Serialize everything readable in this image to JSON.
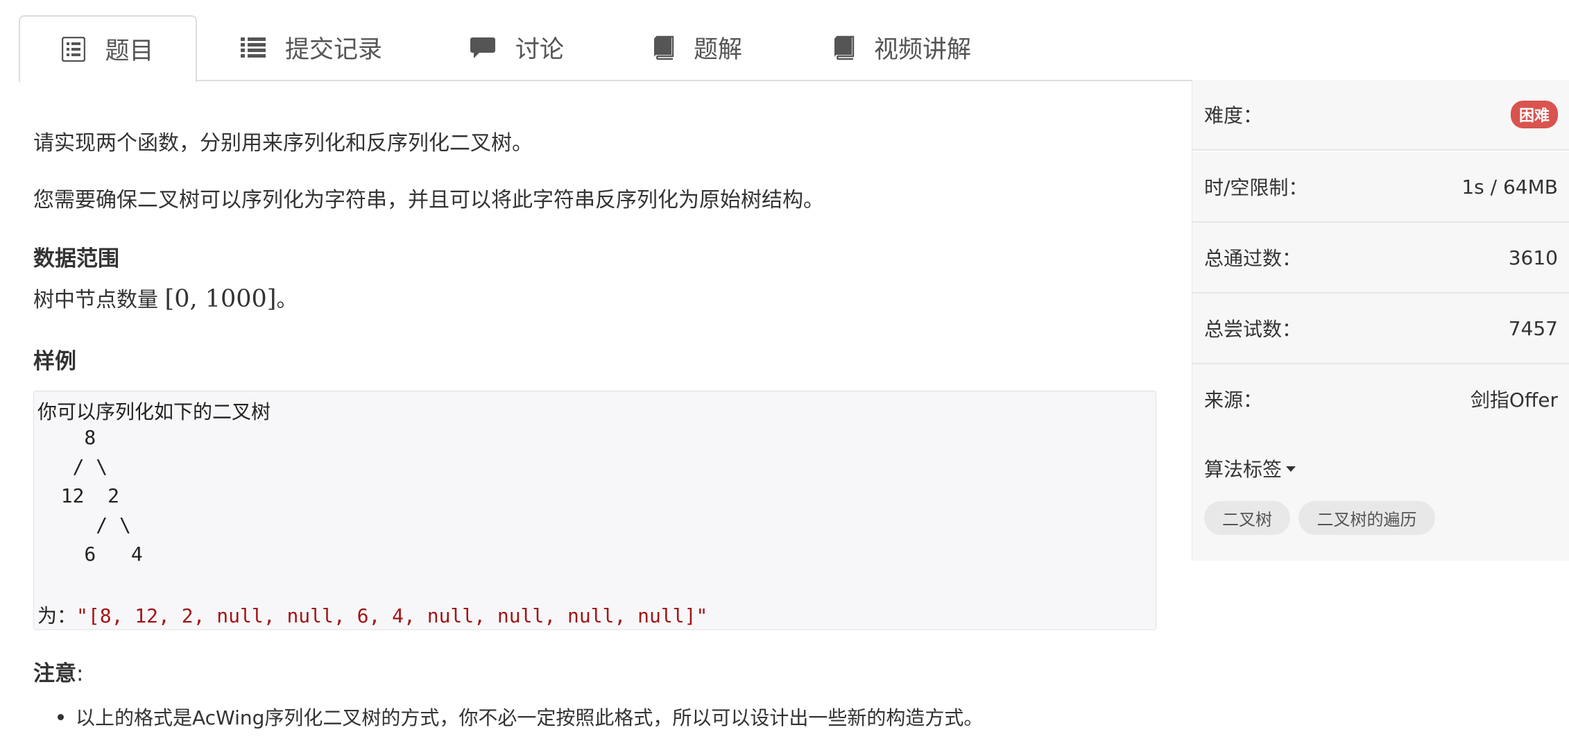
{
  "tabs": [
    {
      "label": "题目",
      "icon": "document-list-icon",
      "active": true
    },
    {
      "label": "提交记录",
      "icon": "list-icon",
      "active": false
    },
    {
      "label": "讨论",
      "icon": "comment-icon",
      "active": false
    },
    {
      "label": "题解",
      "icon": "book-icon",
      "active": false
    },
    {
      "label": "视频讲解",
      "icon": "book-icon",
      "active": false
    }
  ],
  "problem": {
    "intro": "请实现两个函数，分别用来序列化和反序列化二叉树。",
    "desc": "您需要确保二叉树可以序列化为字符串，并且可以将此字符串反序列化为原始树结构。",
    "range_heading": "数据范围",
    "range_prefix": "树中节点数量 ",
    "range_math": "[0, 1000]",
    "range_suffix": "。",
    "sample_heading": "样例",
    "code": {
      "line1": "你可以序列化如下的二叉树",
      "tree": [
        "    8",
        "   / \\",
        "  12  2",
        "     / \\",
        "    6   4"
      ],
      "result_prefix": "为：",
      "result_str": "\"[8, 12, 2, null, null, 6, 4, null, null, null, null]\""
    },
    "note_heading": "注意",
    "note_colon": ":",
    "notes": [
      "以上的格式是AcWing序列化二叉树的方式，你不必一定按照此格式，所以可以设计出一些新的构造方式。"
    ]
  },
  "sidebar": {
    "difficulty_label": "难度：",
    "difficulty_value": "困难",
    "limit_label": "时/空限制：",
    "limit_value": "1s / 64MB",
    "passed_label": "总通过数：",
    "passed_value": "3610",
    "attempts_label": "总尝试数：",
    "attempts_value": "7457",
    "source_label": "来源：",
    "source_value": "剑指Offer",
    "tags_title": "算法标签",
    "tags": [
      "二叉树",
      "二叉树的遍历"
    ]
  },
  "colors": {
    "difficulty_badge": "#d9534f",
    "string_literal": "#a31515"
  }
}
